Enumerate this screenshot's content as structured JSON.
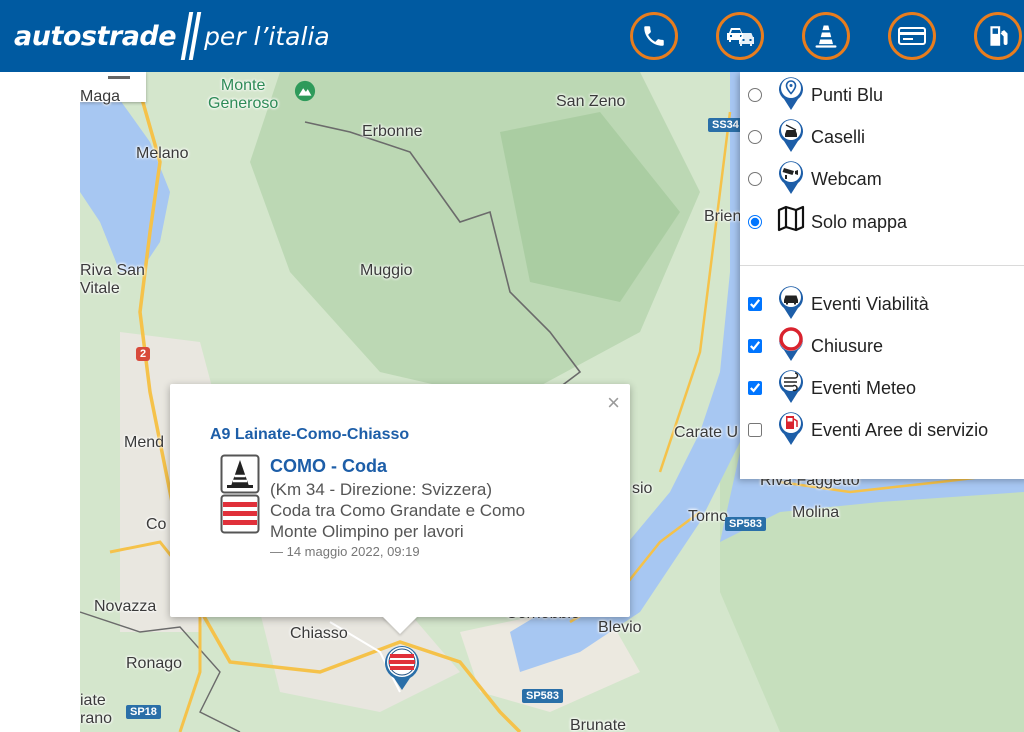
{
  "header": {
    "brand": "autostrade",
    "tagline": "per l’italia",
    "buttons": [
      {
        "name": "phone-icon",
        "color": "#e87d1e"
      },
      {
        "name": "traffic-icon",
        "color": "#e87d1e"
      },
      {
        "name": "roadworks-cone-icon",
        "color": "#e87d1e"
      },
      {
        "name": "card-payment-icon",
        "color": "#e87d1e"
      },
      {
        "name": "fuel-pump-icon",
        "color": "#e87d1e"
      }
    ]
  },
  "map": {
    "labels": {
      "monte": "Monte\nGeneroso",
      "mag": "Maga",
      "melano": "Melano",
      "erbonne": "Erbonne",
      "sanzeno": "San Zeno",
      "brien": "Brien",
      "muggio": "Muggio",
      "rivasan": "Riva San\nVitale",
      "mend": "Mend",
      "co": "Co",
      "carate": "Carate U",
      "rivafaggetto": "Riva Faggetto",
      "torno": "Torno",
      "molina": "Molina",
      "novazza": "Novazza",
      "chiasso": "Chiasso",
      "cernobbio": "Cernobbio",
      "blevio": "Blevio",
      "ronago": "Ronago",
      "iate": "iate\nrano",
      "brunate": "Brunate",
      "sio": "sio"
    },
    "shields": {
      "ss34": "SS34",
      "r2": "2",
      "sp583a": "SP583",
      "sp583b": "SP583",
      "sp18": "SP18"
    }
  },
  "layers": {
    "radio": [
      {
        "label": "Punti Blu",
        "checked": false
      },
      {
        "label": "Caselli",
        "checked": false
      },
      {
        "label": "Webcam",
        "checked": false
      },
      {
        "label": "Solo mappa",
        "checked": true
      }
    ],
    "checks": [
      {
        "label": "Eventi Viabilità",
        "checked": true
      },
      {
        "label": "Chiusure",
        "checked": true
      },
      {
        "label": "Eventi Meteo",
        "checked": true
      },
      {
        "label": "Eventi Aree di servizio",
        "checked": false
      }
    ]
  },
  "popup": {
    "road": "A9 Lainate-Como-Chiasso",
    "title": "COMO - Coda",
    "km": "(Km 34 - Direzione: Svizzera)",
    "desc1": "Coda tra Como Grandate e Como",
    "desc2": "Monte Olimpino per lavori",
    "date": "— 14 maggio 2022, 09:19",
    "close": "×"
  },
  "colors": {
    "header": "#005aa1",
    "accent": "#e87d1e",
    "link": "#1d5ea8"
  }
}
